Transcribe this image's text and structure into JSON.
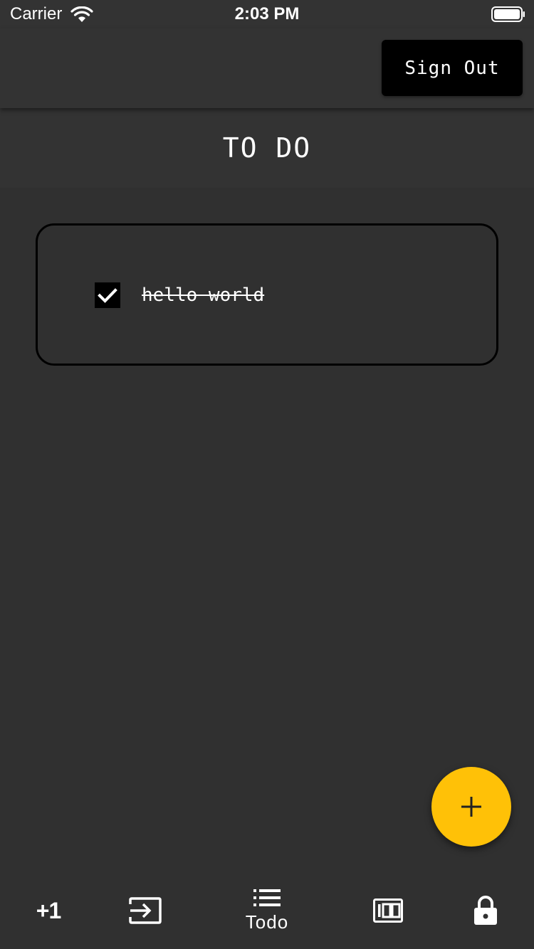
{
  "status_bar": {
    "carrier": "Carrier",
    "time": "2:03 PM",
    "wifi_icon": "wifi-icon",
    "battery_icon": "battery-icon"
  },
  "app_bar": {
    "sign_out_label": "Sign Out"
  },
  "page": {
    "title": "TO DO"
  },
  "todos": [
    {
      "text": "hello world",
      "completed": true
    }
  ],
  "fab": {
    "icon": "plus-icon",
    "color": "#FFC107"
  },
  "bottom_nav": {
    "items": [
      {
        "icon": "plus-one-icon",
        "text": "+1"
      },
      {
        "icon": "input-icon"
      },
      {
        "icon": "list-icon",
        "label": "Todo",
        "active": true
      },
      {
        "icon": "counter-100-icon"
      },
      {
        "icon": "lock-icon"
      }
    ]
  },
  "colors": {
    "background": "#303030",
    "bar": "#333333",
    "accent": "#FFC107",
    "button": "#000000",
    "text": "#FFFFFF"
  }
}
